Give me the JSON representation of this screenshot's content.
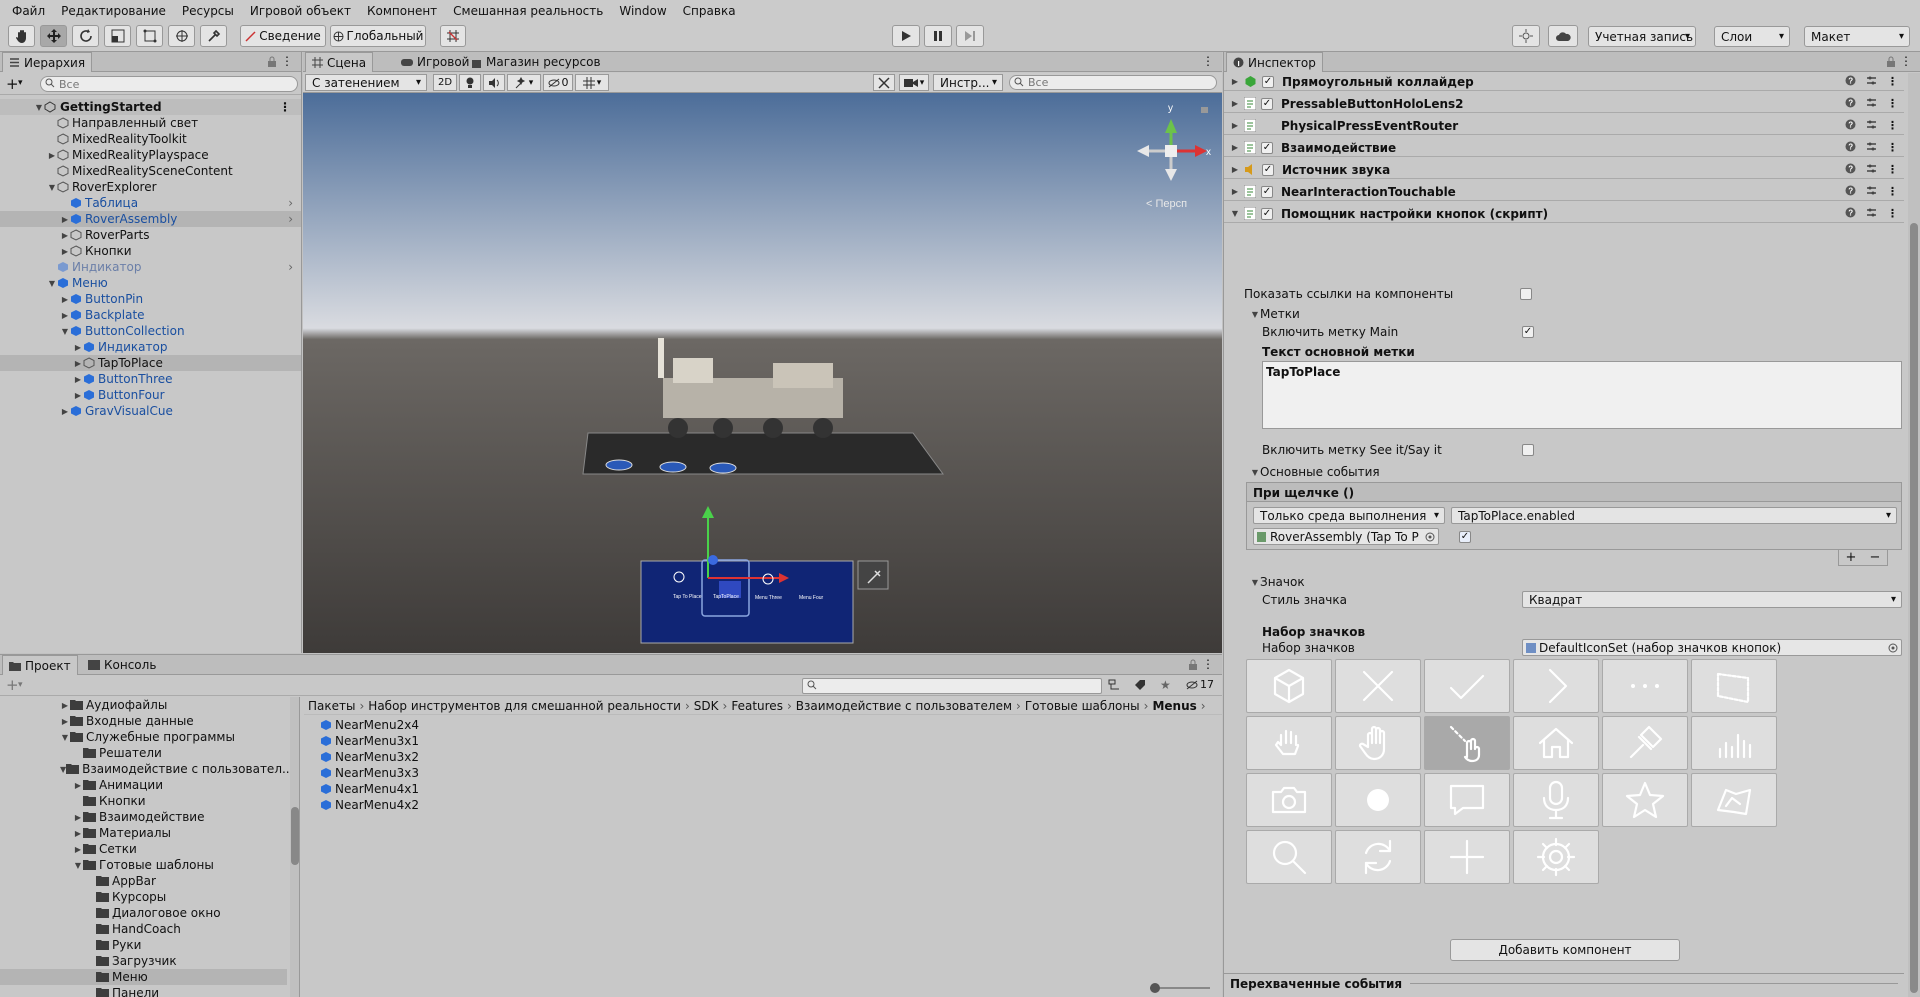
{
  "menubar": [
    "Файл",
    "Редактирование",
    "Ресурсы",
    "Игровой объект",
    "Компонент",
    "Смешанная реальность",
    "Window",
    "Справка"
  ],
  "toolbar": {
    "pivot_label": "Сведение",
    "global_label": "Глобальный",
    "account_label": "Учетная запись",
    "layers_label": "Слои",
    "layout_label": "Макет"
  },
  "hierarchy": {
    "tab": "Иерархия",
    "search_placeholder": "Все",
    "scene": "GettingStarted",
    "items": [
      {
        "label": "Направленный свет",
        "depth": 1,
        "arrow": "",
        "color": "normal"
      },
      {
        "label": "MixedRealityToolkit",
        "depth": 1,
        "arrow": "",
        "color": "normal"
      },
      {
        "label": "MixedRealityPlayspace",
        "depth": 1,
        "arrow": "▶",
        "color": "normal"
      },
      {
        "label": "MixedRealitySceneContent",
        "depth": 1,
        "arrow": "",
        "color": "normal"
      },
      {
        "label": "RoverExplorer",
        "depth": 1,
        "arrow": "▼",
        "color": "normal"
      },
      {
        "label": "Таблица",
        "depth": 2,
        "arrow": "",
        "color": "blue",
        "chev": ">"
      },
      {
        "label": "RoverAssembly",
        "depth": 2,
        "arrow": "▶",
        "color": "blue",
        "chev": ">",
        "sel": true
      },
      {
        "label": "RoverParts",
        "depth": 2,
        "arrow": "▶",
        "color": "normal"
      },
      {
        "label": "Кнопки",
        "depth": 2,
        "arrow": "▶",
        "color": "normal"
      },
      {
        "label": "Индикатор",
        "depth": 1,
        "arrow": "",
        "color": "grey",
        "chev": ">"
      },
      {
        "label": "Меню",
        "depth": 1,
        "arrow": "▼",
        "color": "blue"
      },
      {
        "label": "ButtonPin",
        "depth": 2,
        "arrow": "▶",
        "color": "blue"
      },
      {
        "label": "Backplate",
        "depth": 2,
        "arrow": "▶",
        "color": "blue"
      },
      {
        "label": "ButtonCollection",
        "depth": 2,
        "arrow": "▼",
        "color": "blue"
      },
      {
        "label": "Индикатор",
        "depth": 3,
        "arrow": "▶",
        "color": "blue"
      },
      {
        "label": "TapToPlace",
        "depth": 3,
        "arrow": "▶",
        "color": "normal",
        "sel": true
      },
      {
        "label": "ButtonThree",
        "depth": 3,
        "arrow": "▶",
        "color": "blue"
      },
      {
        "label": "ButtonFour",
        "depth": 3,
        "arrow": "▶",
        "color": "blue"
      },
      {
        "label": "GravVisualCue",
        "depth": 2,
        "arrow": "▶",
        "color": "blue"
      }
    ]
  },
  "scene": {
    "tabs": [
      "Сцена",
      "Игровой",
      "Магазин ресурсов"
    ],
    "shading": "С затенением",
    "mode_2d": "2D",
    "hidden_count": "0",
    "tools_label": "Инстр...",
    "search_placeholder": "Все",
    "persp_label": "< Персп",
    "axis_y": "y",
    "axis_x": "x",
    "menu_buttons": [
      "Tap To Place",
      "TapToPlace",
      "Menu Three",
      "Menu Four"
    ]
  },
  "project": {
    "tabs": [
      "Проект",
      "Консоль"
    ],
    "hidden_count": "17",
    "tree": [
      {
        "label": "Аудиофайлы",
        "depth": 0,
        "arrow": "▶"
      },
      {
        "label": "Входные данные",
        "depth": 0,
        "arrow": "▶"
      },
      {
        "label": "Служебные программы",
        "depth": 0,
        "arrow": "▼"
      },
      {
        "label": "Решатели",
        "depth": 1,
        "arrow": ""
      },
      {
        "label": "Взаимодействие с пользовател...",
        "depth": 0,
        "arrow": "▼"
      },
      {
        "label": "Анимации",
        "depth": 1,
        "arrow": "▶"
      },
      {
        "label": "Кнопки",
        "depth": 1,
        "arrow": ""
      },
      {
        "label": "Взаимодействие",
        "depth": 1,
        "arrow": "▶"
      },
      {
        "label": "Материалы",
        "depth": 1,
        "arrow": "▶"
      },
      {
        "label": "Сетки",
        "depth": 1,
        "arrow": "▶"
      },
      {
        "label": "Готовые шаблоны",
        "depth": 1,
        "arrow": "▼"
      },
      {
        "label": "AppBar",
        "depth": 2,
        "arrow": ""
      },
      {
        "label": "Курсоры",
        "depth": 2,
        "arrow": ""
      },
      {
        "label": "Диалоговое окно",
        "depth": 2,
        "arrow": ""
      },
      {
        "label": "HandCoach",
        "depth": 2,
        "arrow": ""
      },
      {
        "label": "Руки",
        "depth": 2,
        "arrow": ""
      },
      {
        "label": "Загрузчик",
        "depth": 2,
        "arrow": ""
      },
      {
        "label": "Меню",
        "depth": 2,
        "arrow": "",
        "sel": true
      },
      {
        "label": "Панели",
        "depth": 2,
        "arrow": ""
      }
    ],
    "breadcrumb": [
      "Пакеты",
      "Набор инструментов для смешанной реальности",
      "SDK",
      "Features",
      "Взаимодействие с пользователем",
      "Готовые шаблоны",
      "Menus"
    ],
    "files": [
      "NearMenu2x4",
      "NearMenu3x1",
      "NearMenu3x2",
      "NearMenu3x3",
      "NearMenu4x1",
      "NearMenu4x2"
    ]
  },
  "inspector": {
    "tab": "Инспектор",
    "components": [
      {
        "name": "Прямоугольный коллайдер",
        "checked": true,
        "icon": "collider"
      },
      {
        "name": "PressableButtonHoloLens2",
        "checked": true,
        "icon": "script"
      },
      {
        "name": "PhysicalPressEventRouter",
        "checked": false,
        "icon": "script",
        "nocheck": true
      },
      {
        "name": "Взаимодействие",
        "checked": true,
        "icon": "script"
      },
      {
        "name": "Источник звука",
        "checked": true,
        "icon": "audio"
      },
      {
        "name": "NearInteractionTouchable",
        "checked": true,
        "icon": "script"
      },
      {
        "name": "Помощник настройки кнопок (скрипт)",
        "checked": true,
        "icon": "script",
        "expanded": true
      }
    ],
    "show_refs": "Показать ссылки на компоненты",
    "labels_header": "Метки",
    "enable_main": "Включить метку Main",
    "main_text_label": "Текст основной метки",
    "main_text_value": "TapToPlace",
    "enable_seeit": "Включить метку See it/Say it",
    "events_header": "Основные события",
    "on_click": "При щелчке ()",
    "runtime_only": "Только среда выполнения",
    "function": "TapToPlace.enabled",
    "object_ref": "RoverAssembly (Tap To P",
    "plus": "+",
    "minus": "−",
    "icon_header": "Значок",
    "icon_style_label": "Стиль значка",
    "icon_style_value": "Квадрат",
    "iconset_header": "Набор значков",
    "iconset_label": "Набор значков",
    "iconset_value": "DefaultIconSet (набор значков кнопок)",
    "icons": [
      "cube-icon",
      "close-icon",
      "check-icon",
      "chevron-right-icon",
      "ellipsis-icon",
      "tag-icon",
      "hand-ray-icon",
      "hand-icon",
      "hand-pointer-icon",
      "home-icon",
      "pin-icon",
      "chart-icon",
      "camera-icon",
      "record-icon",
      "speech-bubble-icon",
      "microphone-icon",
      "star-icon",
      "map-icon",
      "search-icon",
      "refresh-icon",
      "plus-icon",
      "gear-icon"
    ],
    "add_component": "Добавить компонент",
    "intercepted_events": "Перехваченные события"
  }
}
